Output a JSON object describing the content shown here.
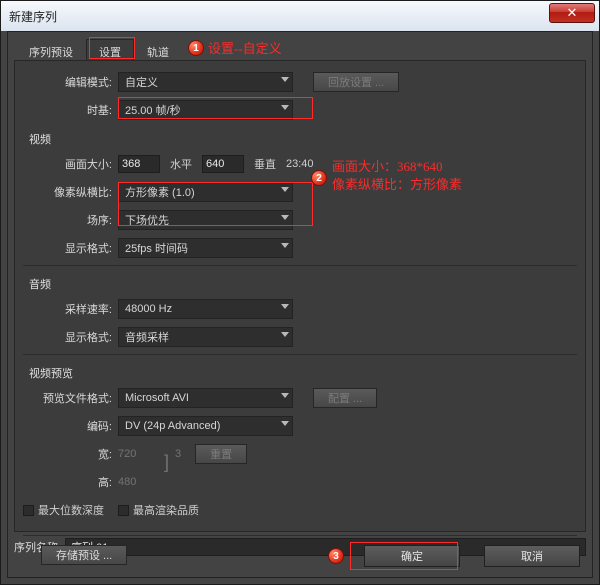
{
  "window": {
    "title": "新建序列",
    "close": "✕"
  },
  "tabs": {
    "presets": "序列预设",
    "settings": "设置",
    "tracks": "轨道"
  },
  "annotations": {
    "a1": "设置--自定义",
    "a2a": "画面大小：368*640",
    "a2b": "像素纵横比：方形像素"
  },
  "labels": {
    "editMode": "编辑模式:",
    "timebase": "时基:",
    "video": "视频",
    "frameSize": "画面大小:",
    "horiz": "水平",
    "vert": "垂直",
    "ratio": "23:40",
    "par": "像素纵横比:",
    "fields": "场序:",
    "dispFmtV": "显示格式:",
    "audio": "音频",
    "sampleRate": "采样速率:",
    "dispFmtA": "显示格式:",
    "preview": "视频预览",
    "prevFmt": "预览文件格式:",
    "codec": "编码:",
    "width": "宽:",
    "height": "高:",
    "link": "3",
    "maxbit": "最大位数深度",
    "maxrender": "最高渲染品质",
    "savePreset": "存储预设 ...",
    "playback": "回放设置 ...",
    "config": "配置 ...",
    "reset": "重置"
  },
  "values": {
    "editMode": "自定义",
    "timebase": "25.00 帧/秒",
    "w": "368",
    "h": "640",
    "par": "方形像素 (1.0)",
    "fields": "下场优先",
    "dispV": "25fps 时间码",
    "sample": "48000 Hz",
    "dispA": "音频采样",
    "prevFmt": "Microsoft AVI",
    "codec": "DV (24p Advanced)",
    "pw": "720",
    "ph": "480"
  },
  "seq": {
    "label": "序列名称:",
    "value": "序列 01"
  },
  "buttons": {
    "ok": "确定",
    "cancel": "取消"
  }
}
